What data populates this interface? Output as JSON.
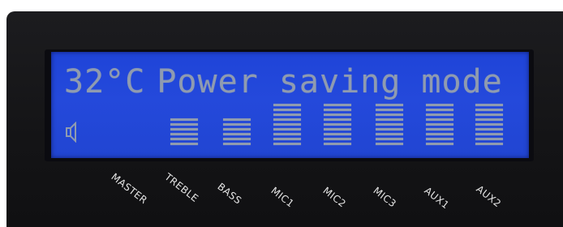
{
  "display": {
    "temperature": "32°C",
    "status": "Power saving mode"
  },
  "channels": [
    {
      "label": "MASTER",
      "level": 0
    },
    {
      "label": "TREBLE",
      "level": 6
    },
    {
      "label": "BASS",
      "level": 6
    },
    {
      "label": "MIC1",
      "level": 9
    },
    {
      "label": "MIC2",
      "level": 9
    },
    {
      "label": "MIC3",
      "level": 9
    },
    {
      "label": "AUX1",
      "level": 9
    },
    {
      "label": "AUX2",
      "level": 9
    }
  ],
  "colors": {
    "lcd_background": "#2247d8",
    "lcd_text": "#8f9bb0",
    "panel": "#151517",
    "label": "#e6e6e6"
  },
  "icons": {
    "volume": "speaker-icon"
  }
}
